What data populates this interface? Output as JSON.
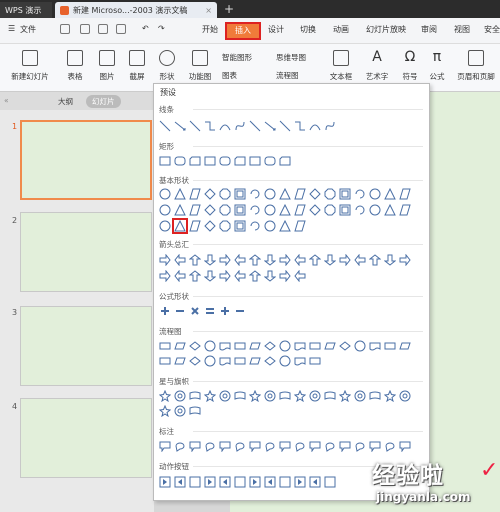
{
  "titlebar": {
    "app_tab": "WPS 演示",
    "doc_tab": "新建 Microso...-2003 演示文稿",
    "new_tab": "+"
  },
  "menubar": {
    "file": "文件",
    "items": [
      "开始",
      "插入",
      "设计",
      "切换",
      "动画",
      "幻灯片放映",
      "审阅",
      "视图",
      "安全"
    ]
  },
  "ribbon": {
    "buttons": [
      "新建幻灯片",
      "表格",
      "图片",
      "截屏",
      "形状",
      "功能图",
      "智能图形",
      "图表",
      "思维导图",
      "流程图",
      "文本框",
      "艺术字",
      "符号",
      "公式",
      "页眉和页脚"
    ]
  },
  "left_panel": {
    "tab_outline": "大纲",
    "tab_slides": "幻灯片",
    "slides": [
      "1",
      "2",
      "3",
      "4"
    ]
  },
  "shapes_dropdown": {
    "header": "预设",
    "sections": [
      "线条",
      "矩形",
      "基本形状",
      "箭头总汇",
      "公式形状",
      "流程图",
      "星与旗帜",
      "标注",
      "动作按钮"
    ]
  },
  "watermark": {
    "line1": "经验啦",
    "line2": "jingyanla.com",
    "check": "✓"
  },
  "colors": {
    "accent": "#f07b3a",
    "highlight": "#dd2222",
    "slide_bg": "#e2efda"
  }
}
